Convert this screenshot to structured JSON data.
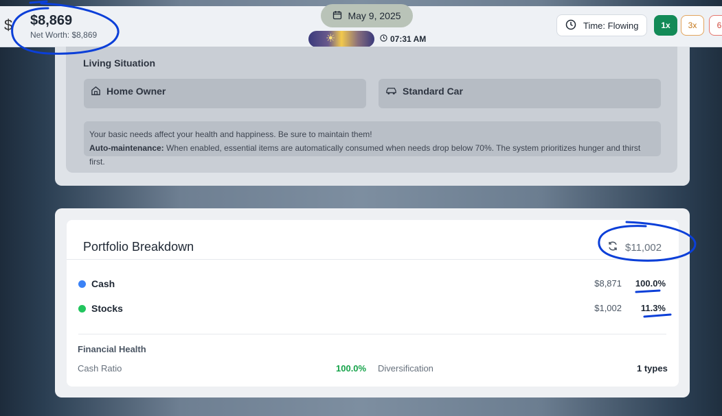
{
  "header": {
    "currency_symbol": "$",
    "cash": "$8,869",
    "net_worth": "Net Worth: $8,869",
    "date": "May 9, 2025",
    "time": "07:31 AM",
    "time_mode": "Time: Flowing",
    "speeds": [
      "1x",
      "3x",
      "6"
    ],
    "active_speed": "1x"
  },
  "living": {
    "title": "Living Situation",
    "home": "Home Owner",
    "car": "Standard Car",
    "note_line1": "Your basic needs affect your health and happiness. Be sure to maintain them!",
    "note_bold": "Auto-maintenance:",
    "note_line2": " When enabled, essential items are automatically consumed when needs drop below 70%. The system prioritizes hunger and thirst first."
  },
  "portfolio": {
    "title": "Portfolio Breakdown",
    "total": "$11,002",
    "rows": [
      {
        "label": "Cash",
        "value": "$8,871",
        "percent": "100.0%",
        "color": "#3b82f6"
      },
      {
        "label": "Stocks",
        "value": "$1,002",
        "percent": "11.3%",
        "color": "#22c55e"
      }
    ],
    "health_title": "Financial Health",
    "cash_ratio_label": "Cash Ratio",
    "cash_ratio_value": "100.0%",
    "diversification_label": "Diversification",
    "diversification_value": "1 types"
  },
  "colors": {
    "accent_green": "#138a57",
    "positive": "#16a34a",
    "annotation": "#0b3fd8"
  },
  "icons": [
    "calendar-icon",
    "sun-icon",
    "clock-icon",
    "home-icon",
    "car-icon",
    "refresh-icon"
  ]
}
